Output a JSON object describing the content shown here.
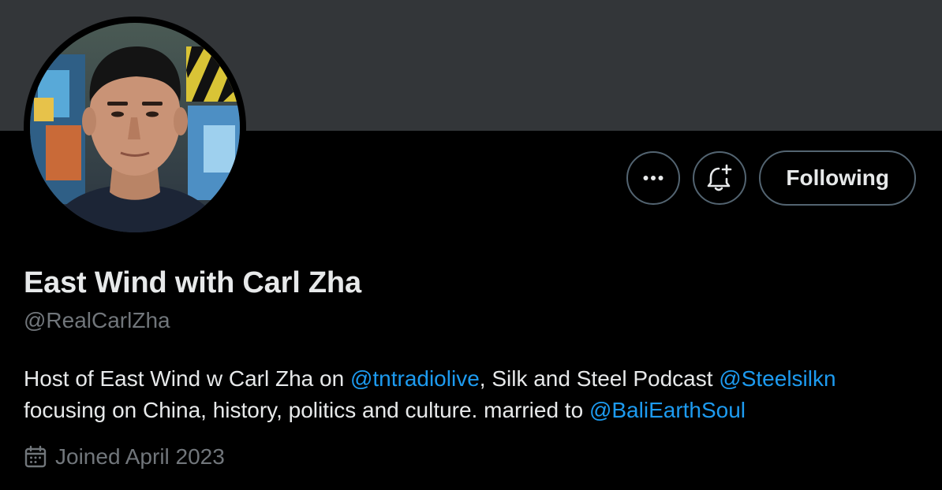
{
  "colors": {
    "background": "#000000",
    "banner": "#333639",
    "primary_text": "#e7e9ea",
    "secondary_text": "#71767b",
    "link": "#1d9bf0",
    "button_border": "#536471"
  },
  "header": {
    "avatar_icon": "profile-photo",
    "more_icon": "more-horizontal-icon",
    "notify_icon": "bell-plus-icon",
    "following_label": "Following"
  },
  "profile": {
    "display_name": "East Wind with Carl Zha",
    "handle": "@RealCarlZha",
    "bio": {
      "t1": "Host of East Wind w Carl Zha on ",
      "m1": "@tntradiolive",
      "t2": ", Silk and Steel Podcast ",
      "m2": "@Steelsilkn",
      "t3": "focusing on China, history, politics and culture. married to ",
      "m3": "@BaliEarthSoul"
    },
    "joined_icon": "calendar-icon",
    "joined": "Joined April 2023"
  }
}
